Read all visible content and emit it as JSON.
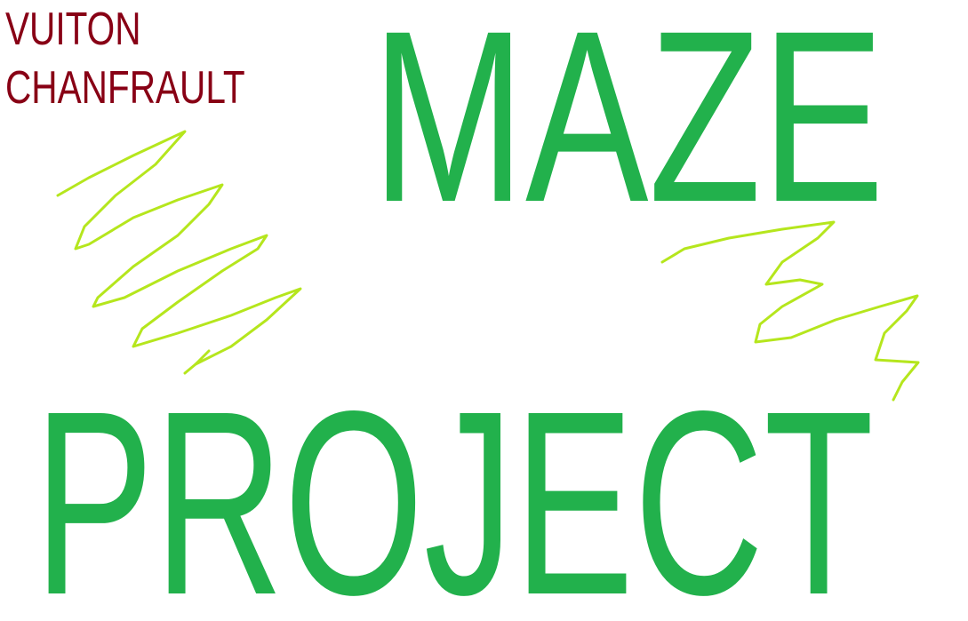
{
  "drawing": {
    "author_signature": "VUITON CHANFRAULT",
    "title_top": "MAZE",
    "title_bottom": "PROJECT"
  },
  "colors": {
    "background": "#ffffff",
    "title": "#22b14c",
    "scribbles": "#b5e61d",
    "signature": "#880015"
  }
}
